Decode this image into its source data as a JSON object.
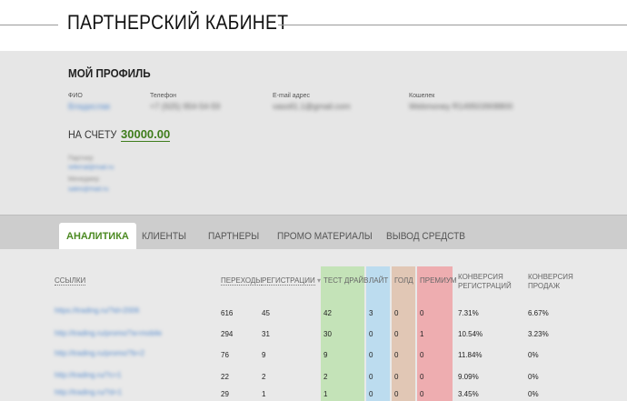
{
  "header": {
    "title": "ПАРТНЕРСКИЙ КАБИНЕТ"
  },
  "profile": {
    "title": "МОЙ ПРОФИЛЬ",
    "fields": [
      {
        "label": "ФИО",
        "value": "Владислав"
      },
      {
        "label": "Телефон",
        "value": "+7 (925) 954-54-59"
      },
      {
        "label": "E-mail адрес",
        "value": "vasoll1.1@gmail.com"
      },
      {
        "label": "Кошелек",
        "value": "Webmoney R149503908800"
      }
    ],
    "balance_label": "НА СЧЕТУ",
    "balance_value": "30000.00",
    "extra": [
      {
        "label": "Партнер",
        "link": "referral@mail.ru"
      },
      {
        "label": "Менеджер",
        "link": "sales@mail.ru"
      }
    ]
  },
  "tabs": [
    "АНАЛИТИКА",
    "КЛИЕНТЫ",
    "ПАРТНЕРЫ",
    "ПРОМО МАТЕРИАЛЫ",
    "ВЫВОД СРЕДСТВ"
  ],
  "table": {
    "headers": {
      "links": "ССЫЛКИ",
      "visits": "ПЕРЕХОДЫ",
      "registrations": "РЕГИСТРАЦИИ",
      "test_drive": "ТЕСТ ДРАЙВ",
      "lite": "ЛАЙТ",
      "gold": "ГОЛД",
      "premium": "ПРЕМИУМ",
      "conv_reg_1": "КОНВЕРСИЯ",
      "conv_reg_2": "РЕГИСТРАЦИЙ",
      "conv_sales_1": "КОНВЕРСИЯ",
      "conv_sales_2": "ПРОДАЖ"
    },
    "sort_glyph": "▾",
    "rows": [
      {
        "link": "https://trading.ru/?id=2006",
        "visits": "616",
        "registrations": "45",
        "test_drive": "42",
        "lite": "3",
        "gold": "0",
        "premium": "0",
        "conv_reg": "7.31%",
        "conv_sales": "6.67%"
      },
      {
        "link": "http://trading.ru/promo/?a=mobile",
        "visits": "294",
        "registrations": "31",
        "test_drive": "30",
        "lite": "0",
        "gold": "0",
        "premium": "1",
        "conv_reg": "10.54%",
        "conv_sales": "3.23%"
      },
      {
        "link": "http://trading.ru/promo/?b=2",
        "visits": "76",
        "registrations": "9",
        "test_drive": "9",
        "lite": "0",
        "gold": "0",
        "premium": "0",
        "conv_reg": "11.84%",
        "conv_sales": "0%"
      },
      {
        "link": "http://trading.ru/?c=1",
        "visits": "22",
        "registrations": "2",
        "test_drive": "2",
        "lite": "0",
        "gold": "0",
        "premium": "0",
        "conv_reg": "9.09%",
        "conv_sales": "0%"
      },
      {
        "link": "http://trading.ru/?d=1",
        "visits": "29",
        "registrations": "1",
        "test_drive": "1",
        "lite": "0",
        "gold": "0",
        "premium": "0",
        "conv_reg": "3.45%",
        "conv_sales": "0%"
      }
    ]
  },
  "colors": {
    "accent_green": "#4c8a22",
    "test_drive_bg": "#c4e3b8",
    "lite_bg": "#bcdcef",
    "gold_bg": "#e1c7b5",
    "premium_bg": "#eeadb0"
  }
}
